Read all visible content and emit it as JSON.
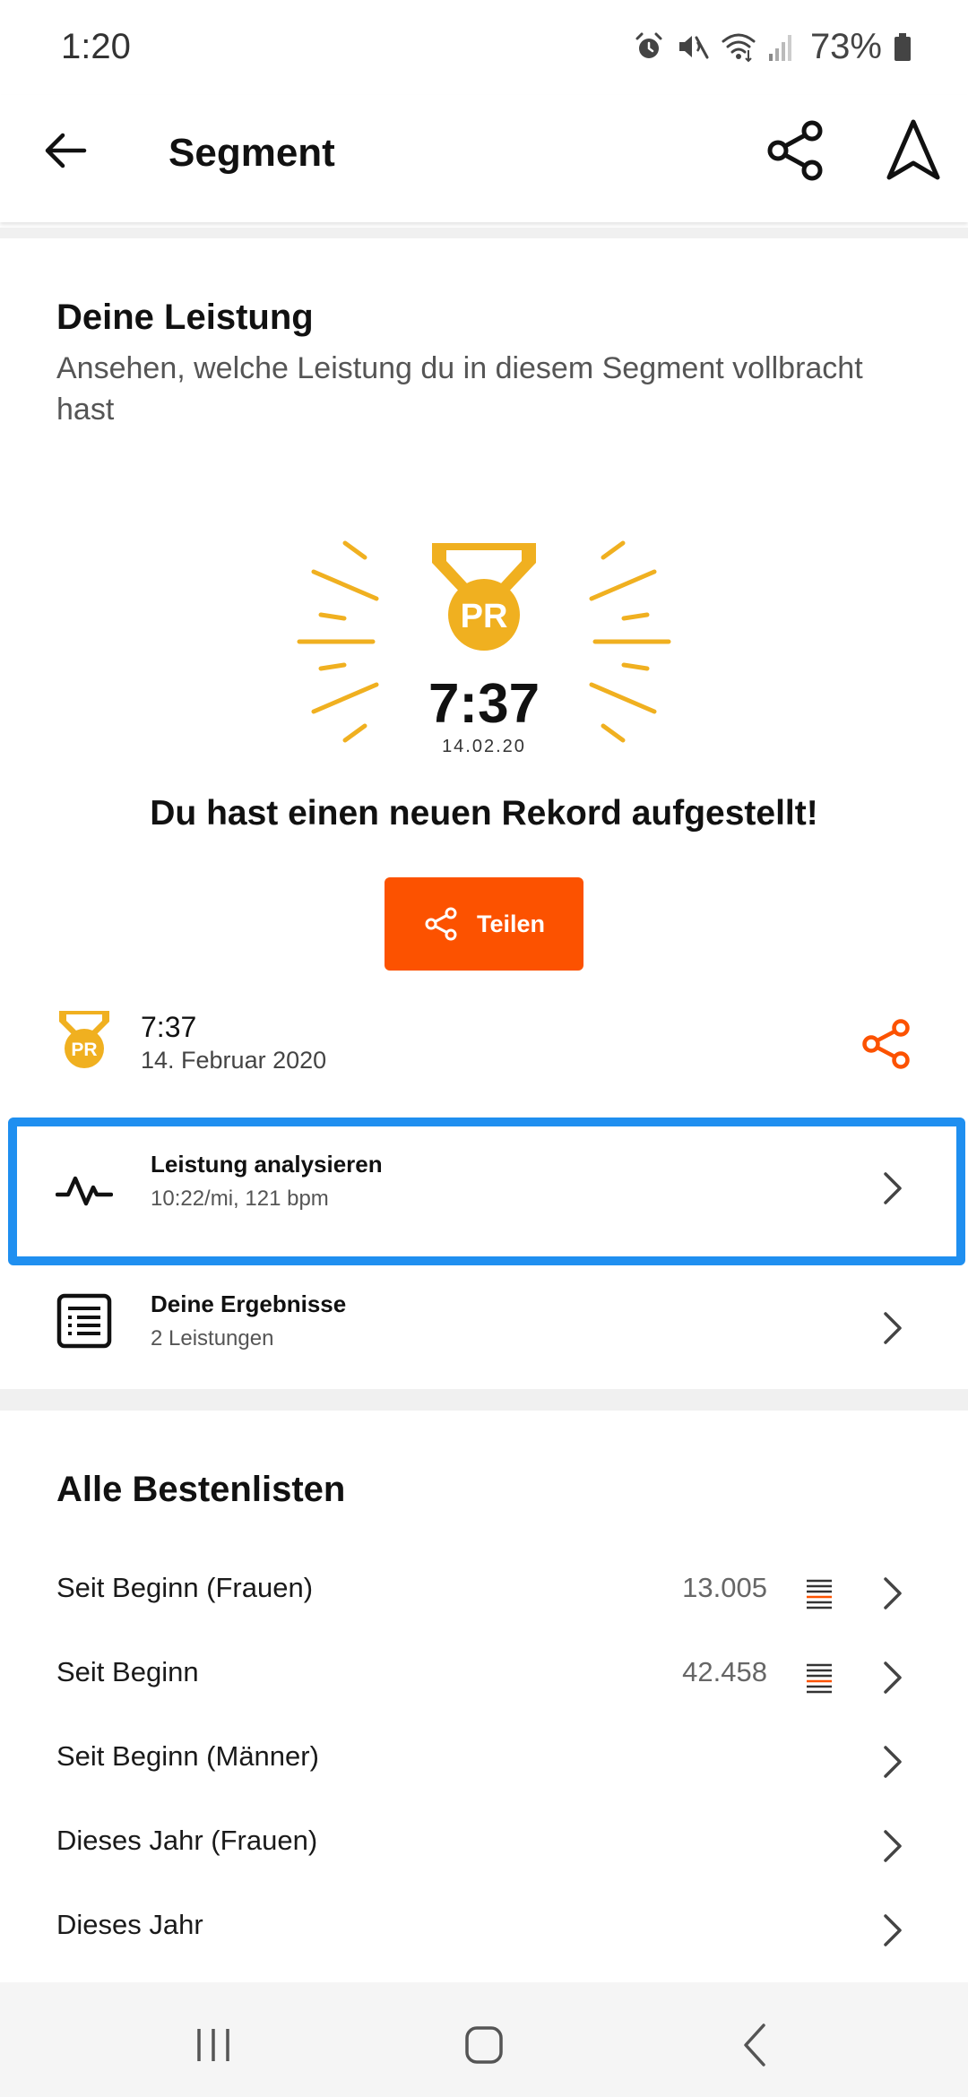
{
  "status_bar": {
    "time": "1:20",
    "battery": "73%",
    "icons": [
      "alarm-icon",
      "mute-icon",
      "wifi-icon",
      "signal-icon",
      "battery-icon"
    ]
  },
  "header": {
    "title": "Segment",
    "icons": [
      "back-arrow-icon",
      "share-icon",
      "navigate-icon"
    ]
  },
  "performance": {
    "title": "Deine Leistung",
    "subtitle": "Ansehen, welche Leistung du in diesem Segment vollbracht hast",
    "medal_text": "PR",
    "pr_time": "7:37",
    "pr_date": "14.02.20",
    "record_heading": "Du hast einen neuen Rekord aufgestellt!",
    "share_button": "Teilen"
  },
  "effort": {
    "medal_text": "PR",
    "time": "7:37",
    "date": "14. Februar 2020"
  },
  "rows": [
    {
      "title": "Leistung analysieren",
      "subtitle": "10:22/mi, 121 bpm",
      "icon": "pulse-icon"
    },
    {
      "title": "Deine Ergebnisse",
      "subtitle": "2 Leistungen",
      "icon": "results-list-icon"
    }
  ],
  "leaderboards": {
    "title": "Alle Bestenlisten",
    "items": [
      {
        "label": "Seit Beginn (Frauen)",
        "count": "13.005"
      },
      {
        "label": "Seit Beginn",
        "count": "42.458"
      },
      {
        "label": "Seit Beginn (Männer)",
        "count": ""
      },
      {
        "label": "Dieses Jahr (Frauen)",
        "count": ""
      },
      {
        "label": "Dieses Jahr",
        "count": ""
      }
    ]
  },
  "colors": {
    "accent": "#fc5200",
    "medal": "#f0b020",
    "highlight": "#1f8ff0"
  }
}
